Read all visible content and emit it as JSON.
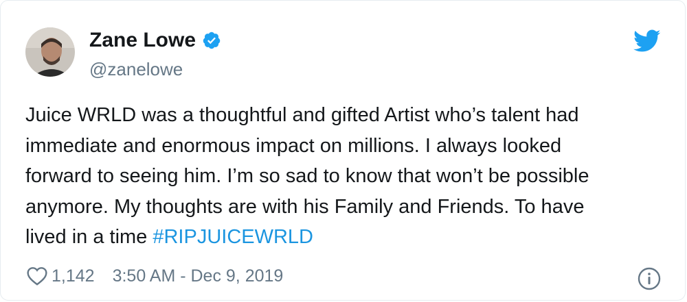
{
  "tweet": {
    "author_name": "Zane Lowe",
    "author_handle": "@zanelowe",
    "text_before_hashtag": "Juice WRLD was a thoughtful and gifted Artist who’s talent had\nimmediate and enormous impact on millions. I always looked\nforward to seeing him. I’m so sad to know that won’t be possible\nanymore. My thoughts are with his Family and Friends. To have\nlived in a time ",
    "hashtag": "#RIPJUICEWRLD",
    "likes": "1,142",
    "timestamp": "3:50 AM - Dec 9, 2019"
  },
  "icons": {
    "verified": "verified-badge-icon",
    "brand": "twitter-bird-icon",
    "like": "heart-icon",
    "info": "info-icon"
  },
  "colors": {
    "brand_blue": "#1da1f2",
    "link_blue": "#1b95e0",
    "secondary_text": "#657786",
    "primary_text": "#14171a"
  }
}
